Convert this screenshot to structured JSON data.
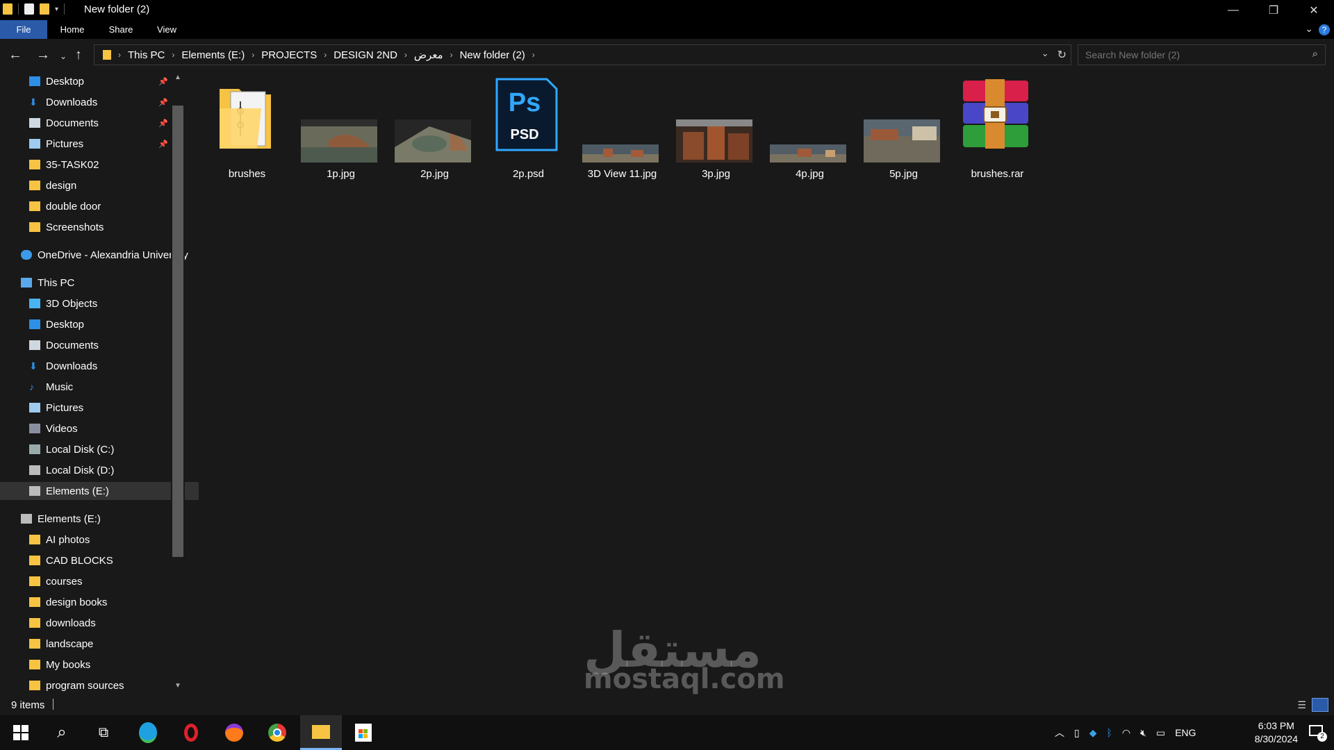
{
  "window": {
    "title": "New folder (2)"
  },
  "ribbon": {
    "tabs": [
      "File",
      "Home",
      "Share",
      "View"
    ]
  },
  "address": {
    "crumbs": [
      "This PC",
      "Elements (E:)",
      "PROJECTS",
      "DESIGN 2ND",
      "معرض",
      "New folder (2)"
    ]
  },
  "search": {
    "placeholder": "Search New folder (2)"
  },
  "sidebar": {
    "quick": [
      "Desktop",
      "Downloads",
      "Documents",
      "Pictures",
      "35-TASK02",
      "design",
      "double door",
      "Screenshots"
    ],
    "onedrive": "OneDrive - Alexandria University",
    "thispc": "This PC",
    "pc_items": [
      "3D Objects",
      "Desktop",
      "Documents",
      "Downloads",
      "Music",
      "Pictures",
      "Videos",
      "Local Disk (C:)",
      "Local Disk (D:)",
      "Elements (E:)"
    ],
    "drive": "Elements (E:)",
    "drive_items": [
      "AI photos",
      "CAD BLOCKS",
      "courses",
      "design books",
      "downloads",
      "landscape",
      "My books",
      "program sources"
    ]
  },
  "files": [
    "brushes",
    "1p.jpg",
    "2p.jpg",
    "2p.psd",
    "3D View 11.jpg",
    "3p.jpg",
    "4p.jpg",
    "5p.jpg",
    "brushes.rar"
  ],
  "psd_badge": {
    "top": "Ps",
    "bottom": "PSD"
  },
  "status": {
    "count": "9 items"
  },
  "taskbar": {
    "lang": "ENG",
    "time": "6:03 PM",
    "date": "8/30/2024",
    "notif": "2"
  },
  "watermark": {
    "text": "mostaql.com",
    "arabic": "مستقل"
  }
}
